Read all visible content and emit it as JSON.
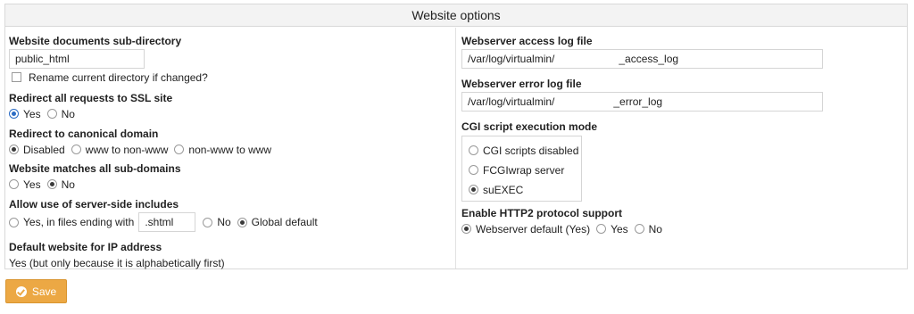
{
  "panel": {
    "title": "Website options"
  },
  "left": {
    "subdir": {
      "label": "Website documents sub-directory",
      "value": "public_html",
      "rename_label": "Rename current directory if changed?"
    },
    "ssl_redirect": {
      "label": "Redirect all requests to SSL site",
      "options": [
        "Yes",
        "No"
      ],
      "selected": "Yes"
    },
    "canonical": {
      "label": "Redirect to canonical domain",
      "options": [
        "Disabled",
        "www to non-www",
        "non-www to www"
      ],
      "selected": "Disabled"
    },
    "subdomains": {
      "label": "Website matches all sub-domains",
      "options": [
        "Yes",
        "No"
      ],
      "selected": "No"
    },
    "ssi": {
      "label": "Allow use of server-side includes",
      "opt_yes": "Yes, in files ending with",
      "ext_value": ".shtml",
      "opt_no": "No",
      "opt_global": "Global default",
      "selected": "Global default"
    },
    "default_site": {
      "label": "Default website for IP address",
      "value": "Yes (but only because it is alphabetically first)"
    }
  },
  "right": {
    "access_log": {
      "label": "Webserver access log file",
      "value": "/var/log/virtualmin/            _access_log"
    },
    "error_log": {
      "label": "Webserver error log file",
      "value": "/var/log/virtualmin/           _error_log"
    },
    "cgi": {
      "label": "CGI script execution mode",
      "options": [
        "CGI scripts disabled",
        "FCGIwrap server",
        "suEXEC"
      ],
      "selected": "suEXEC"
    },
    "http2": {
      "label": "Enable HTTP2 protocol support",
      "options": [
        "Webserver default (Yes)",
        "Yes",
        "No"
      ],
      "selected": "Webserver default (Yes)"
    }
  },
  "actions": {
    "save_label": "Save"
  },
  "colors": {
    "accent": "#eca844",
    "radio_selected": "#2b6cc4"
  }
}
